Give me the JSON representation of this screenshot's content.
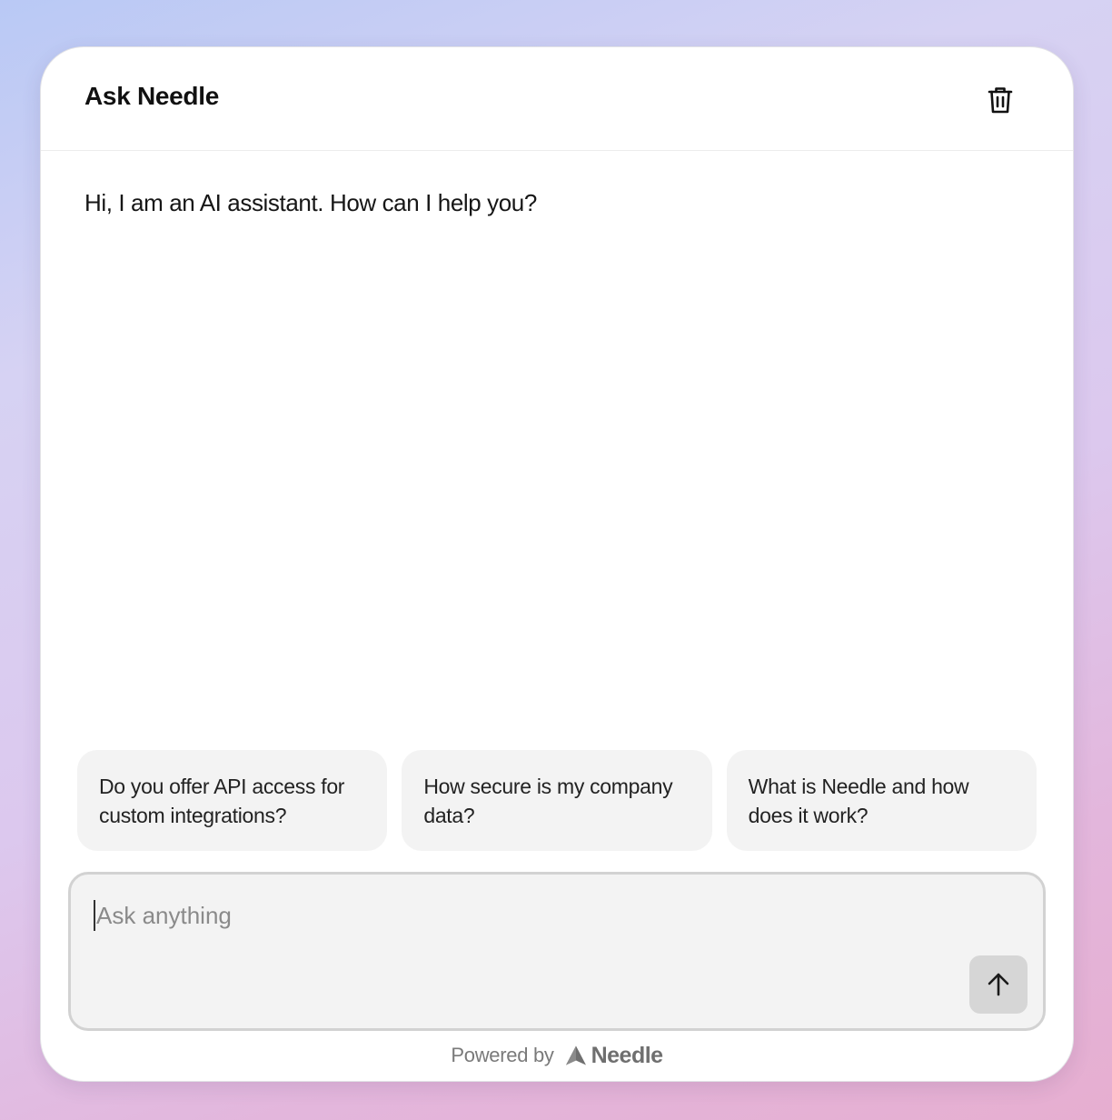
{
  "header": {
    "title": "Ask Needle",
    "clear_icon": "trash-icon"
  },
  "messages": [
    {
      "role": "assistant",
      "text": "Hi, I am an AI assistant. How can I help you?"
    }
  ],
  "suggestions": [
    {
      "text": "Do you offer API access for custom integrations?"
    },
    {
      "text": "How secure is my company data?"
    },
    {
      "text": "What is Needle and how does it work?"
    }
  ],
  "composer": {
    "placeholder": "Ask anything",
    "value": "",
    "send_icon": "arrow-up-icon"
  },
  "footer": {
    "powered_by": "Powered by",
    "brand_name": "Needle",
    "brand_icon": "needle-logo"
  },
  "colors": {
    "card_background": "#ffffff",
    "chip_background": "#f3f3f3",
    "input_background": "#f3f3f3",
    "send_button": "#d6d6d6"
  }
}
